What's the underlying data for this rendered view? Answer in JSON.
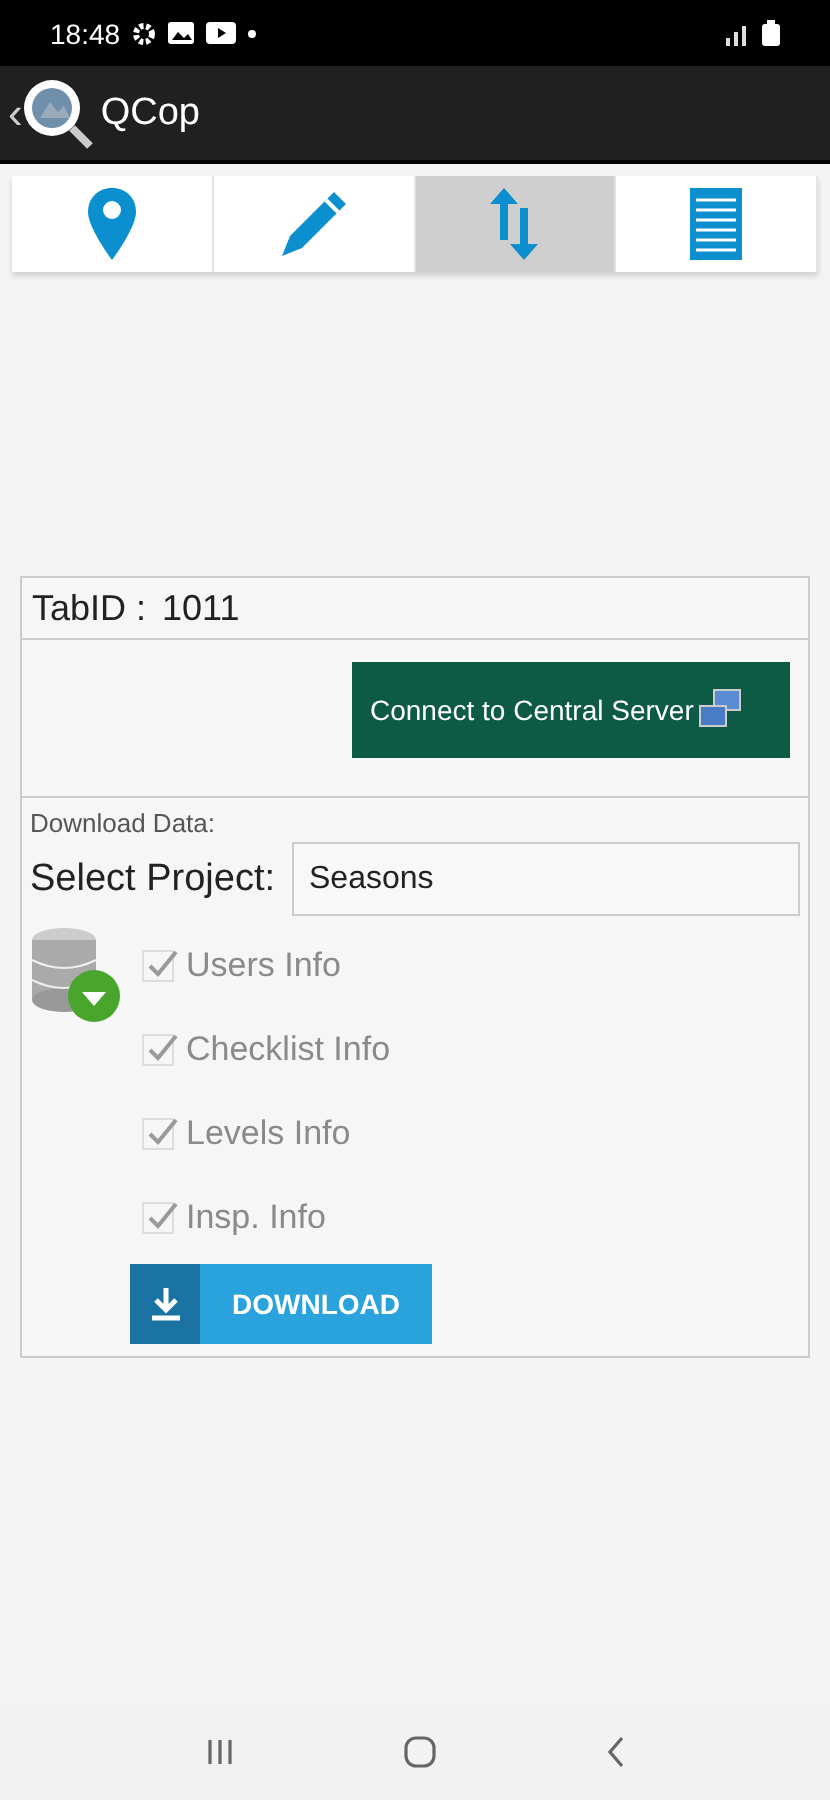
{
  "status_bar": {
    "time": "18:48"
  },
  "app_bar": {
    "back": "‹",
    "title": "QCop"
  },
  "tabs": [
    {
      "kind": "pin",
      "selected": false
    },
    {
      "kind": "pencil",
      "selected": false
    },
    {
      "kind": "sync",
      "selected": true
    },
    {
      "kind": "list",
      "selected": false
    }
  ],
  "tab_id": {
    "label": "TabID :",
    "value": "1011"
  },
  "connect_button": {
    "label": "Connect to Central Server"
  },
  "download_section": {
    "heading": "Download Data:",
    "project_label": "Select Project:",
    "project_value": "Seasons"
  },
  "options": [
    {
      "label": "Users Info",
      "checked": true,
      "disabled": true
    },
    {
      "label": "Checklist Info",
      "checked": true,
      "disabled": true
    },
    {
      "label": "Levels Info",
      "checked": true,
      "disabled": true
    },
    {
      "label": "Insp. Info",
      "checked": true,
      "disabled": true
    }
  ],
  "download_button": {
    "label": "DOWNLOAD"
  }
}
